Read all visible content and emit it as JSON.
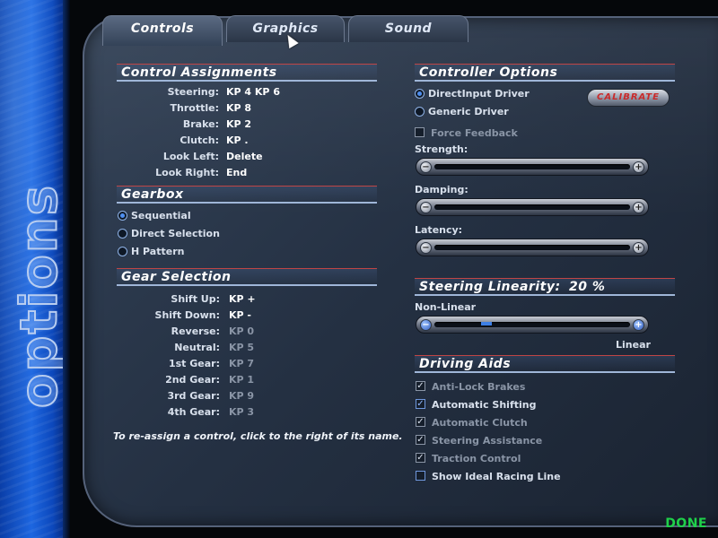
{
  "sidebar": {
    "title": "options"
  },
  "tabs": [
    {
      "label": "Controls"
    },
    {
      "label": "Graphics"
    },
    {
      "label": "Sound"
    }
  ],
  "control_assignments": {
    "header": "Control Assignments",
    "rows": [
      {
        "label": "Steering:",
        "value": "KP 4 KP 6"
      },
      {
        "label": "Throttle:",
        "value": "KP 8"
      },
      {
        "label": "Brake:",
        "value": "KP 2"
      },
      {
        "label": "Clutch:",
        "value": "KP ."
      },
      {
        "label": "Look Left:",
        "value": "Delete"
      },
      {
        "label": "Look Right:",
        "value": "End"
      }
    ]
  },
  "gearbox": {
    "header": "Gearbox",
    "options": [
      {
        "label": "Sequential",
        "selected": true
      },
      {
        "label": "Direct Selection",
        "selected": false
      },
      {
        "label": "H Pattern",
        "selected": false
      }
    ]
  },
  "gear_selection": {
    "header": "Gear Selection",
    "rows": [
      {
        "label": "Shift Up:",
        "value": "KP +"
      },
      {
        "label": "Shift Down:",
        "value": "KP -"
      },
      {
        "label": "Reverse:",
        "value": "KP 0"
      },
      {
        "label": "Neutral:",
        "value": "KP 5"
      },
      {
        "label": "1st Gear:",
        "value": "KP 7"
      },
      {
        "label": "2nd Gear:",
        "value": "KP 1"
      },
      {
        "label": "3rd Gear:",
        "value": "KP 9"
      },
      {
        "label": "4th Gear:",
        "value": "KP 3"
      }
    ],
    "hint": "To re-assign a control, click to the right of its name."
  },
  "controller_options": {
    "header": "Controller Options",
    "drivers": [
      {
        "label": "DirectInput Driver",
        "selected": true
      },
      {
        "label": "Generic Driver",
        "selected": false
      }
    ],
    "calibrate_label": "CALIBRATE",
    "force_feedback": {
      "label": "Force Feedback",
      "checked": false
    },
    "strength_label": "Strength:",
    "damping_label": "Damping:",
    "latency_label": "Latency:",
    "minus_glyph": "−",
    "plus_glyph": "+"
  },
  "steering_linearity": {
    "header": "Steering Linearity:",
    "value": "20 %",
    "value_fraction": 0.2,
    "left_label": "Non-Linear",
    "right_label": "Linear"
  },
  "driving_aids": {
    "header": "Driving Aids",
    "items": [
      {
        "label": "Anti-Lock Brakes",
        "checked": true
      },
      {
        "label": "Automatic Shifting",
        "checked": true
      },
      {
        "label": "Automatic Clutch",
        "checked": true
      },
      {
        "label": "Steering Assistance",
        "checked": true
      },
      {
        "label": "Traction Control",
        "checked": true
      },
      {
        "label": "Show Ideal Racing Line",
        "checked": false
      }
    ],
    "check_glyph": "✓"
  },
  "footer": {
    "done_label": "DONE"
  },
  "colors": {
    "accent_green": "#1fd14a",
    "calibrate_red": "#c92a2a",
    "section_rule_blue": "#9fb6d8",
    "section_rule_red": "#c04545"
  }
}
